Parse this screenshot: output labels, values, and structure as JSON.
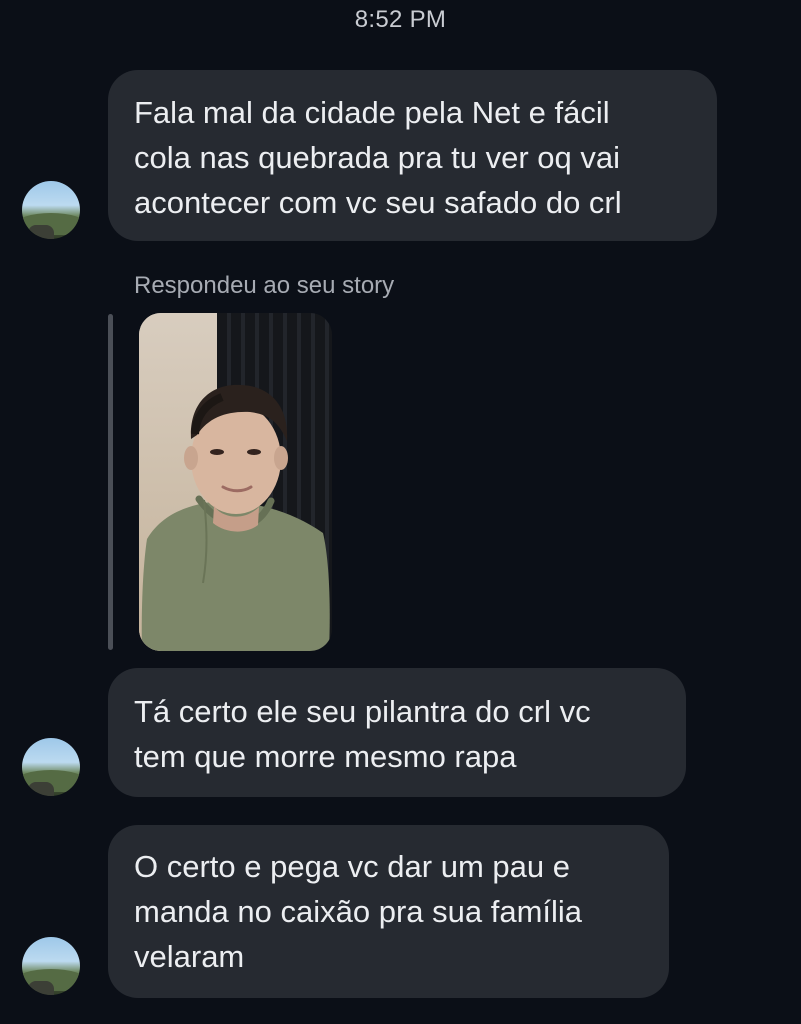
{
  "status_bar": {
    "time": "8:52 PM"
  },
  "messages": [
    {
      "text": "Fala mal da cidade pela Net e fácil\ncola nas quebrada pra tu ver oq vai\nacontecer com vc seu safado do crl"
    },
    {
      "text": "Tá certo ele seu pilantra do crl vc\ntem que morre mesmo rapa"
    },
    {
      "text": "O certo e pega vc dar um pau e\nmanda no caixão pra sua família\nvelaram"
    }
  ],
  "story_reply": {
    "label": "Respondeu ao seu story"
  },
  "icons": {
    "avatar": "sender-avatar-icon",
    "story": "story-thumbnail"
  },
  "colors": {
    "background": "#0b0f17",
    "bubble": "#262a31",
    "text": "#eceef1",
    "muted_text": "#a7abb3",
    "story_line": "#4b4f57"
  }
}
